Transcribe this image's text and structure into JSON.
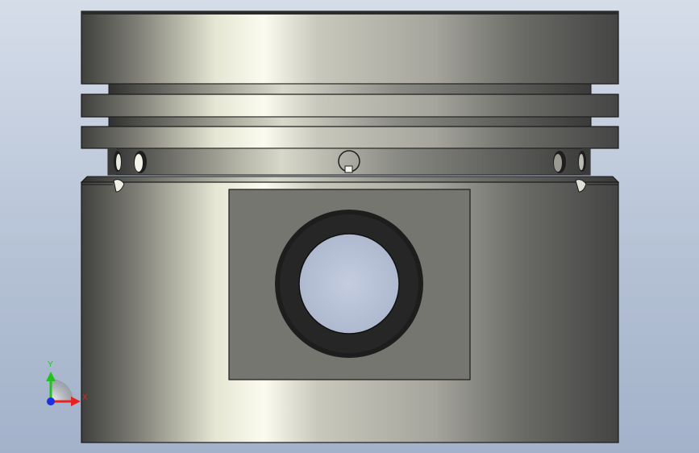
{
  "viewport": {
    "background_top": "#d5dde9",
    "background_bottom": "#a3b2ca"
  },
  "model": {
    "part": "piston",
    "view": "front",
    "metal_dark": "#3c3c3c",
    "metal_light": "#f2f2e6",
    "window_fill": "#75766f",
    "pin_boss_ring": "#1c1c1c",
    "pin_bore": "#b7c1d3"
  },
  "triad": {
    "x_label": "X",
    "y_label": "Y",
    "x_color": "#e8221f",
    "y_color": "#22c11f",
    "z_color": "#1d2fe0"
  }
}
